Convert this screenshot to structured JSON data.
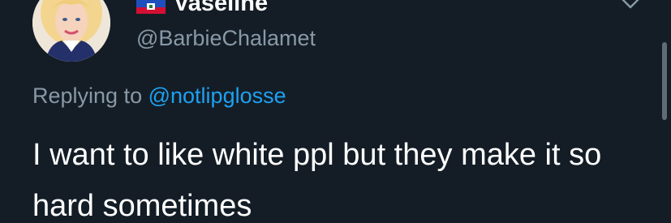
{
  "tweet": {
    "display_name": "Vaseline",
    "handle": "@BarbieChalamet",
    "replying_to_label": "Replying to",
    "replying_to_handle": "@notlipglosse",
    "text": "I want to like white ppl but they make it so hard sometimes"
  },
  "icons": {
    "flag": "haiti-flag-icon",
    "menu": "chevron-down-icon"
  },
  "colors": {
    "background": "#141d26",
    "primary_text": "#ffffff",
    "secondary_text": "#8899a6",
    "link": "#1da1f2"
  }
}
